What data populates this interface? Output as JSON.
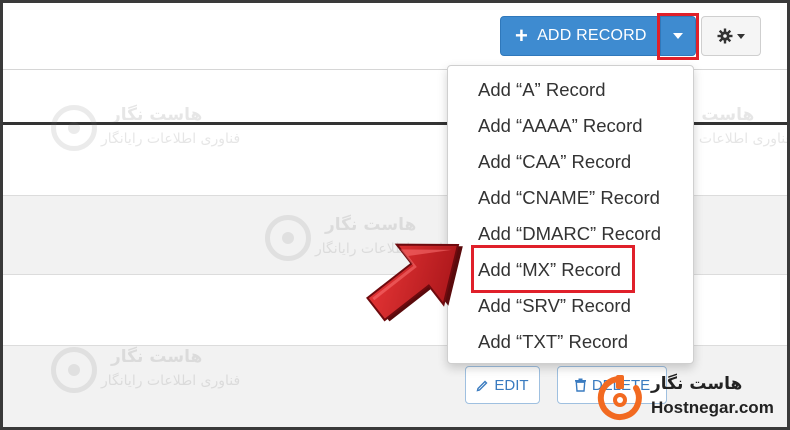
{
  "toolbar": {
    "add_record_label": "ADD RECORD",
    "add_icon": "plus-icon",
    "caret_icon": "caret-down-icon",
    "settings_icon": "gear-icon"
  },
  "dropdown": {
    "items": [
      {
        "label": "Add “A” Record"
      },
      {
        "label": "Add “AAAA” Record"
      },
      {
        "label": "Add “CAA” Record"
      },
      {
        "label": "Add “CNAME” Record"
      },
      {
        "label": "Add “DMARC” Record"
      },
      {
        "label": "Add “MX” Record",
        "highlighted": true
      },
      {
        "label": "Add “SRV” Record"
      },
      {
        "label": "Add “TXT” Record"
      }
    ]
  },
  "row_actions": {
    "edit_label": "EDIT",
    "delete_label": "DELETE",
    "edit_icon": "pencil-icon",
    "delete_icon": "trash-icon"
  },
  "watermark": {
    "title": "هاست نگار",
    "subtitle": "فناوری اطلاعات رایانگار"
  },
  "brand": {
    "name_fa": "هاست نگار",
    "name_en": "Hostnegar.com"
  },
  "colors": {
    "primary": "#3e8bd0",
    "highlight": "#e0202a",
    "arrow": "#c8161e",
    "brand_orange": "#f26a21"
  }
}
